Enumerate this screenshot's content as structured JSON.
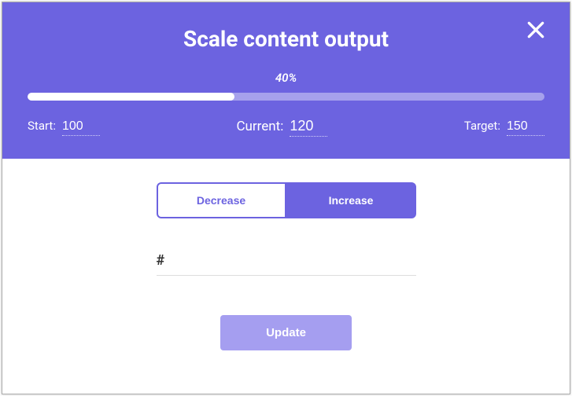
{
  "colors": {
    "primary": "#6c63e0",
    "primary_light": "#a59ef0"
  },
  "modal": {
    "title": "Scale content output",
    "progress": {
      "percent_label": "40%",
      "fill_pct": 40
    },
    "fields": {
      "start_label": "Start:",
      "start_value": "100",
      "current_label": "Current:",
      "current_value": "120",
      "target_label": "Target:",
      "target_value": "150"
    },
    "toggle": {
      "decrease_label": "Decrease",
      "increase_label": "Increase",
      "active": "increase"
    },
    "number_prefix": "#",
    "number_value": "",
    "update_label": "Update"
  }
}
